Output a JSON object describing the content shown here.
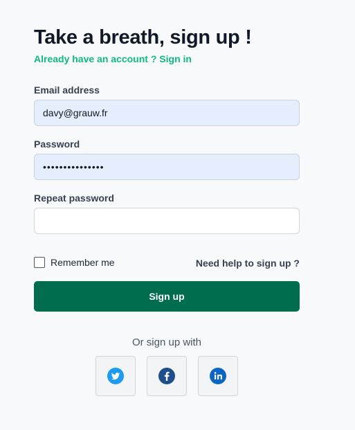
{
  "heading": {
    "title": "Take a breath, sign up !",
    "already_account": "Already have an account ?",
    "sign_in_link": "Sign in"
  },
  "form": {
    "email": {
      "label": "Email address",
      "value": "davy@grauw.fr"
    },
    "password": {
      "label": "Password",
      "value": "•••••••••••••••"
    },
    "repeat_password": {
      "label": "Repeat password",
      "value": ""
    },
    "remember_me": {
      "label": "Remember me",
      "checked": false
    },
    "help_link": "Need help to sign up ?",
    "submit_label": "Sign up"
  },
  "social": {
    "or_text": "Or sign up with",
    "providers": [
      {
        "name": "Twitter",
        "icon": "twitter-icon",
        "color": "#1d9bf0"
      },
      {
        "name": "Facebook",
        "icon": "facebook-icon",
        "color": "#1f4e8c"
      },
      {
        "name": "LinkedIn",
        "icon": "linkedin-icon",
        "color": "#0a66c2"
      }
    ]
  },
  "colors": {
    "accent_green": "#10b981",
    "button_green": "#006d4e",
    "autofill_bg": "#e4eefc"
  }
}
